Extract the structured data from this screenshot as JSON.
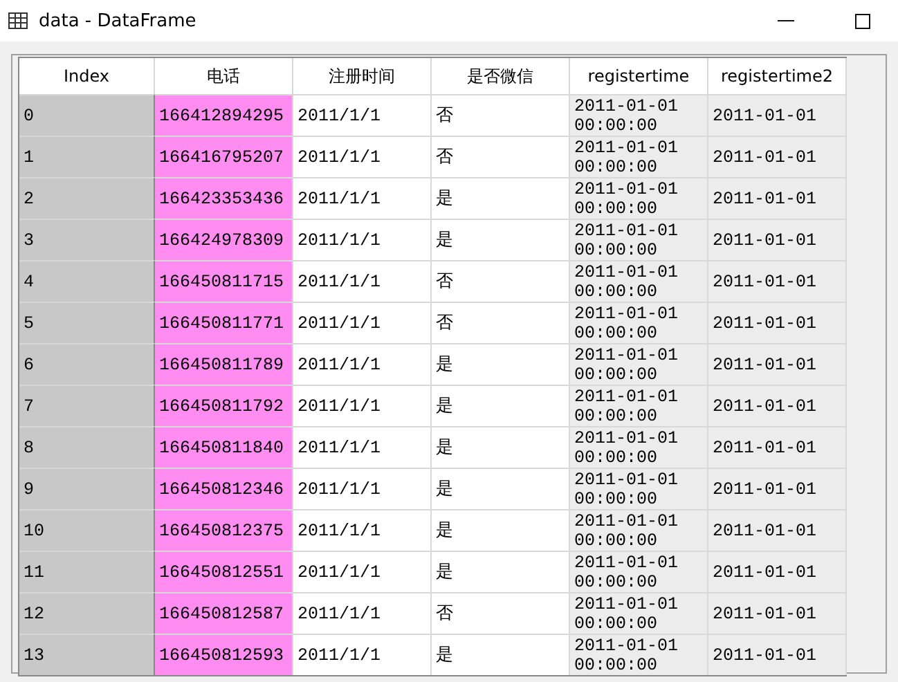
{
  "window": {
    "title": "data - DataFrame"
  },
  "table": {
    "columns": [
      {
        "label": "Index",
        "color": "#c8c8c8"
      },
      {
        "label": "电话",
        "color": "#ff8cf0"
      },
      {
        "label": "注册时间",
        "color": "#ffffff"
      },
      {
        "label": "是否微信",
        "color": "#ffffff"
      },
      {
        "label": "registertime",
        "color": "#ececec"
      },
      {
        "label": "registertime2",
        "color": "#ececec"
      }
    ],
    "rows": [
      [
        "0",
        "166412894295",
        "2011/1/1",
        "否",
        "2011-01-01 00:00:00",
        "2011-01-01"
      ],
      [
        "1",
        "166416795207",
        "2011/1/1",
        "否",
        "2011-01-01 00:00:00",
        "2011-01-01"
      ],
      [
        "2",
        "166423353436",
        "2011/1/1",
        "是",
        "2011-01-01 00:00:00",
        "2011-01-01"
      ],
      [
        "3",
        "166424978309",
        "2011/1/1",
        "是",
        "2011-01-01 00:00:00",
        "2011-01-01"
      ],
      [
        "4",
        "166450811715",
        "2011/1/1",
        "否",
        "2011-01-01 00:00:00",
        "2011-01-01"
      ],
      [
        "5",
        "166450811771",
        "2011/1/1",
        "否",
        "2011-01-01 00:00:00",
        "2011-01-01"
      ],
      [
        "6",
        "166450811789",
        "2011/1/1",
        "是",
        "2011-01-01 00:00:00",
        "2011-01-01"
      ],
      [
        "7",
        "166450811792",
        "2011/1/1",
        "是",
        "2011-01-01 00:00:00",
        "2011-01-01"
      ],
      [
        "8",
        "166450811840",
        "2011/1/1",
        "是",
        "2011-01-01 00:00:00",
        "2011-01-01"
      ],
      [
        "9",
        "166450812346",
        "2011/1/1",
        "是",
        "2011-01-01 00:00:00",
        "2011-01-01"
      ],
      [
        "10",
        "166450812375",
        "2011/1/1",
        "是",
        "2011-01-01 00:00:00",
        "2011-01-01"
      ],
      [
        "11",
        "166450812551",
        "2011/1/1",
        "是",
        "2011-01-01 00:00:00",
        "2011-01-01"
      ],
      [
        "12",
        "166450812587",
        "2011/1/1",
        "否",
        "2011-01-01 00:00:00",
        "2011-01-01"
      ],
      [
        "13",
        "166450812593",
        "2011/1/1",
        "是",
        "2011-01-01 00:00:00",
        "2011-01-01"
      ]
    ]
  }
}
